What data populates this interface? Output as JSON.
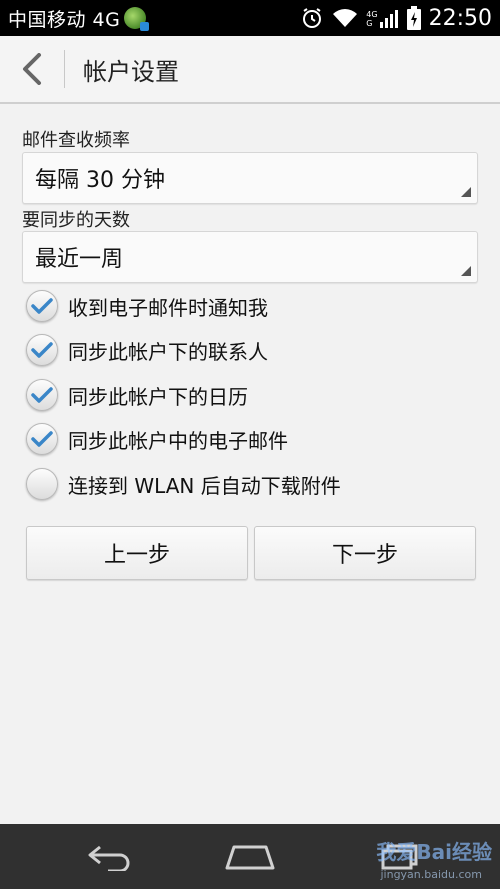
{
  "status_bar": {
    "carrier": "中国移动 4G",
    "time": "22:50",
    "signal_badge_top": "4G",
    "signal_badge_bottom": "G"
  },
  "header": {
    "title": "帐户设置"
  },
  "form": {
    "check_frequency": {
      "label": "邮件查收频率",
      "value": "每隔 30 分钟"
    },
    "sync_days": {
      "label": "要同步的天数",
      "value": "最近一周"
    },
    "options": [
      {
        "label": "收到电子邮件时通知我",
        "checked": true
      },
      {
        "label": "同步此帐户下的联系人",
        "checked": true
      },
      {
        "label": "同步此帐户下的日历",
        "checked": true
      },
      {
        "label": "同步此帐户中的电子邮件",
        "checked": true
      },
      {
        "label": "连接到 WLAN 后自动下载附件",
        "checked": false
      }
    ],
    "prev_label": "上一步",
    "next_label": "下一步"
  },
  "watermark": {
    "brand": "我爱Bai经验",
    "url": "jingyan.baidu.com"
  },
  "colors": {
    "check": "#3a86c8",
    "status_bg": "#000000",
    "nav_bg": "#303030"
  }
}
